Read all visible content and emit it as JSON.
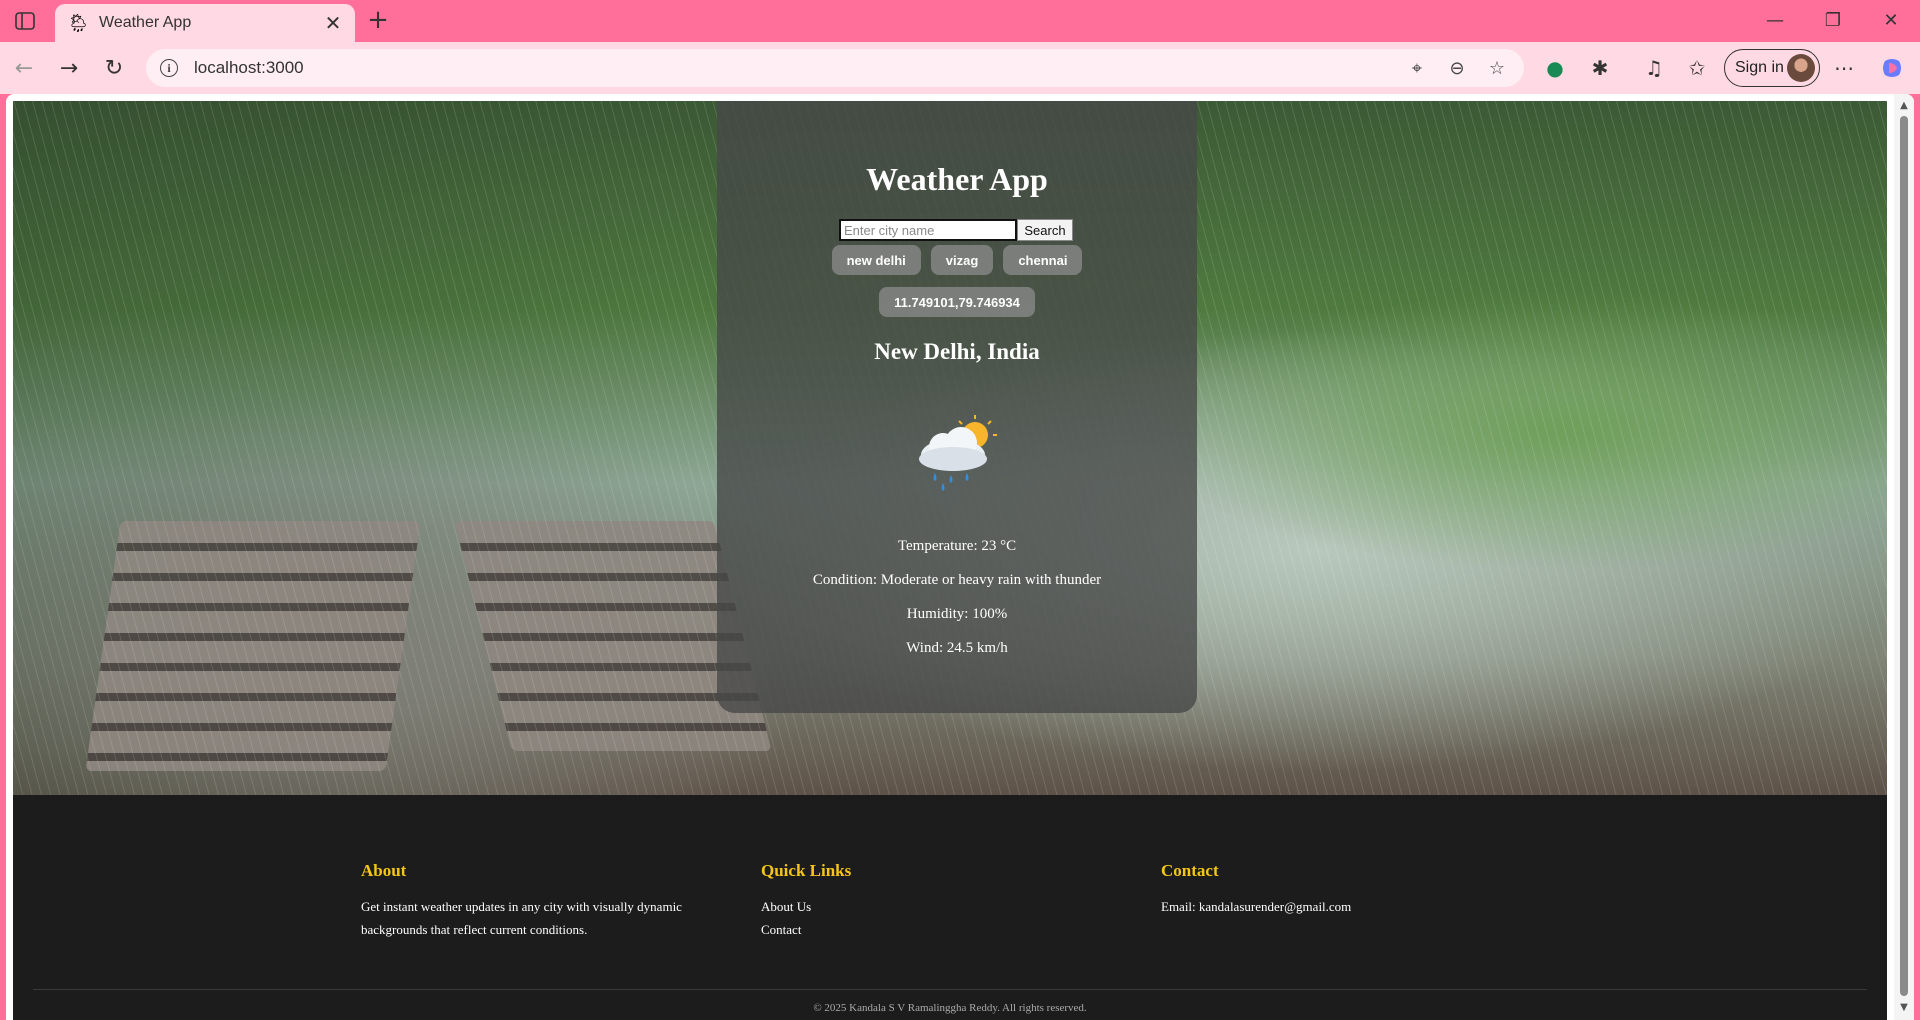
{
  "browser": {
    "tab_title": "Weather App",
    "address": "localhost:3000",
    "sign_in_label": "Sign in",
    "icons": [
      "sidebar-icon",
      "weather-favicon",
      "close-icon",
      "plus-icon",
      "minimize-icon",
      "restore-icon",
      "close-window-icon",
      "back-icon",
      "forward-icon",
      "refresh-icon",
      "info-icon",
      "location-icon",
      "zoom-out-icon",
      "star-icon",
      "grammarly-icon",
      "extensions-icon",
      "media-icon",
      "favorites-icon",
      "more-icon",
      "copilot-icon"
    ]
  },
  "app": {
    "title": "Weather App",
    "search": {
      "placeholder": "Enter city name",
      "button_label": "Search"
    },
    "quick_cities": [
      "new delhi",
      "vizag",
      "chennai"
    ],
    "coords_button": "11.749101,79.746934",
    "location": "New Delhi, India",
    "weather_icon": "rain-thunder-cloud-sun",
    "temperature": "Temperature: 23 °C",
    "condition": "Condition: Moderate or heavy rain with thunder",
    "humidity": "Humidity: 100%",
    "wind": "Wind: 24.5 km/h"
  },
  "footer": {
    "about": {
      "heading": "About",
      "text": "Get instant weather updates in any city with visually dynamic backgrounds that reflect current conditions."
    },
    "quick_links": {
      "heading": "Quick Links",
      "links": [
        "About Us",
        "Contact"
      ]
    },
    "contact": {
      "heading": "Contact",
      "email": "Email: kandalasurender@gmail.com"
    },
    "copyright": "© 2025 Kandala S V Ramalinggha Reddy. All rights reserved."
  },
  "colors": {
    "tab_bar": "#ff6f9a",
    "toolbar": "#ffd9e3",
    "footer_bg": "#1c1c1c",
    "footer_heading": "#f5c518"
  }
}
